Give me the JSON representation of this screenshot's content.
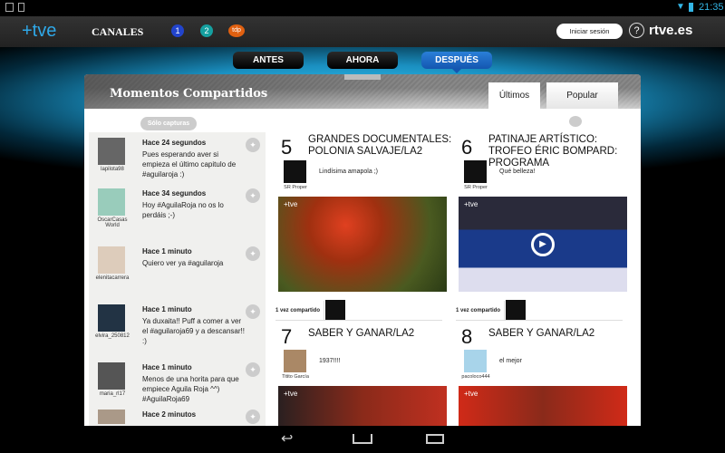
{
  "status": {
    "time": "21:35"
  },
  "header": {
    "logo": "+tve",
    "canales": "CANALES",
    "channels": [
      "1",
      "2",
      "tdp"
    ],
    "login": "Iniciar sesión",
    "help": "?",
    "rtve": "rtve.es"
  },
  "nav_tabs": [
    "ANTES",
    "AHORA",
    "DESPUÉS"
  ],
  "panel": {
    "title": "Momentos Compartidos",
    "tabs": [
      "Últimos",
      "Popular"
    ],
    "filter": "Sólo capturas"
  },
  "tweets": [
    {
      "user": "lapilota98",
      "time": "Hace 24 segundos",
      "text": "Pues esperando aver si empieza el último capitulo de #aguilaroja :)"
    },
    {
      "user": "OscarCasas World",
      "time": "Hace 34 segundos",
      "text": "Hoy #AguilaRoja no os lo perdáis ;-)"
    },
    {
      "user": "elenitacarrera",
      "time": "Hace 1 minuto",
      "text": "Quiero ver ya #aguilaroja"
    },
    {
      "user": "elvira_250812",
      "time": "Hace 1 minuto",
      "text": "Ya duxaita!! Puff a comer a ver el #aguilaroja69 y a descansar!! :)"
    },
    {
      "user": "maria_rl17",
      "time": "Hace 1 minuto",
      "text": "Menos de una horita para que empiece Aguila Roja ^^) #AguilaRoja69"
    },
    {
      "user": "",
      "time": "Hace 2 minutos",
      "text": ""
    }
  ],
  "cards": [
    {
      "num": "5",
      "title": "GRANDES DOCUMENTALES: POLONIA SALVAJE/LA2",
      "user": "SR Proper",
      "comment": "Lindísima amapola ;)",
      "shared": "1 vez compartido",
      "image_label": "+tve"
    },
    {
      "num": "6",
      "title": "PATINAJE ARTÍSTICO: TROFEO ÉRIC BOMPARD: PROGRAMA",
      "user": "SR Proper",
      "comment": "Qué belleza!",
      "shared": "1 vez compartido",
      "image_label": "+tve"
    },
    {
      "num": "7",
      "title": "SABER Y GANAR/LA2",
      "user": "Titito García",
      "comment": "1937!!!!",
      "image_label": "+tve"
    },
    {
      "num": "8",
      "title": "SABER Y GANAR/LA2",
      "user": "pacoloco444",
      "comment": "el mejor",
      "image_label": "+tve"
    }
  ]
}
